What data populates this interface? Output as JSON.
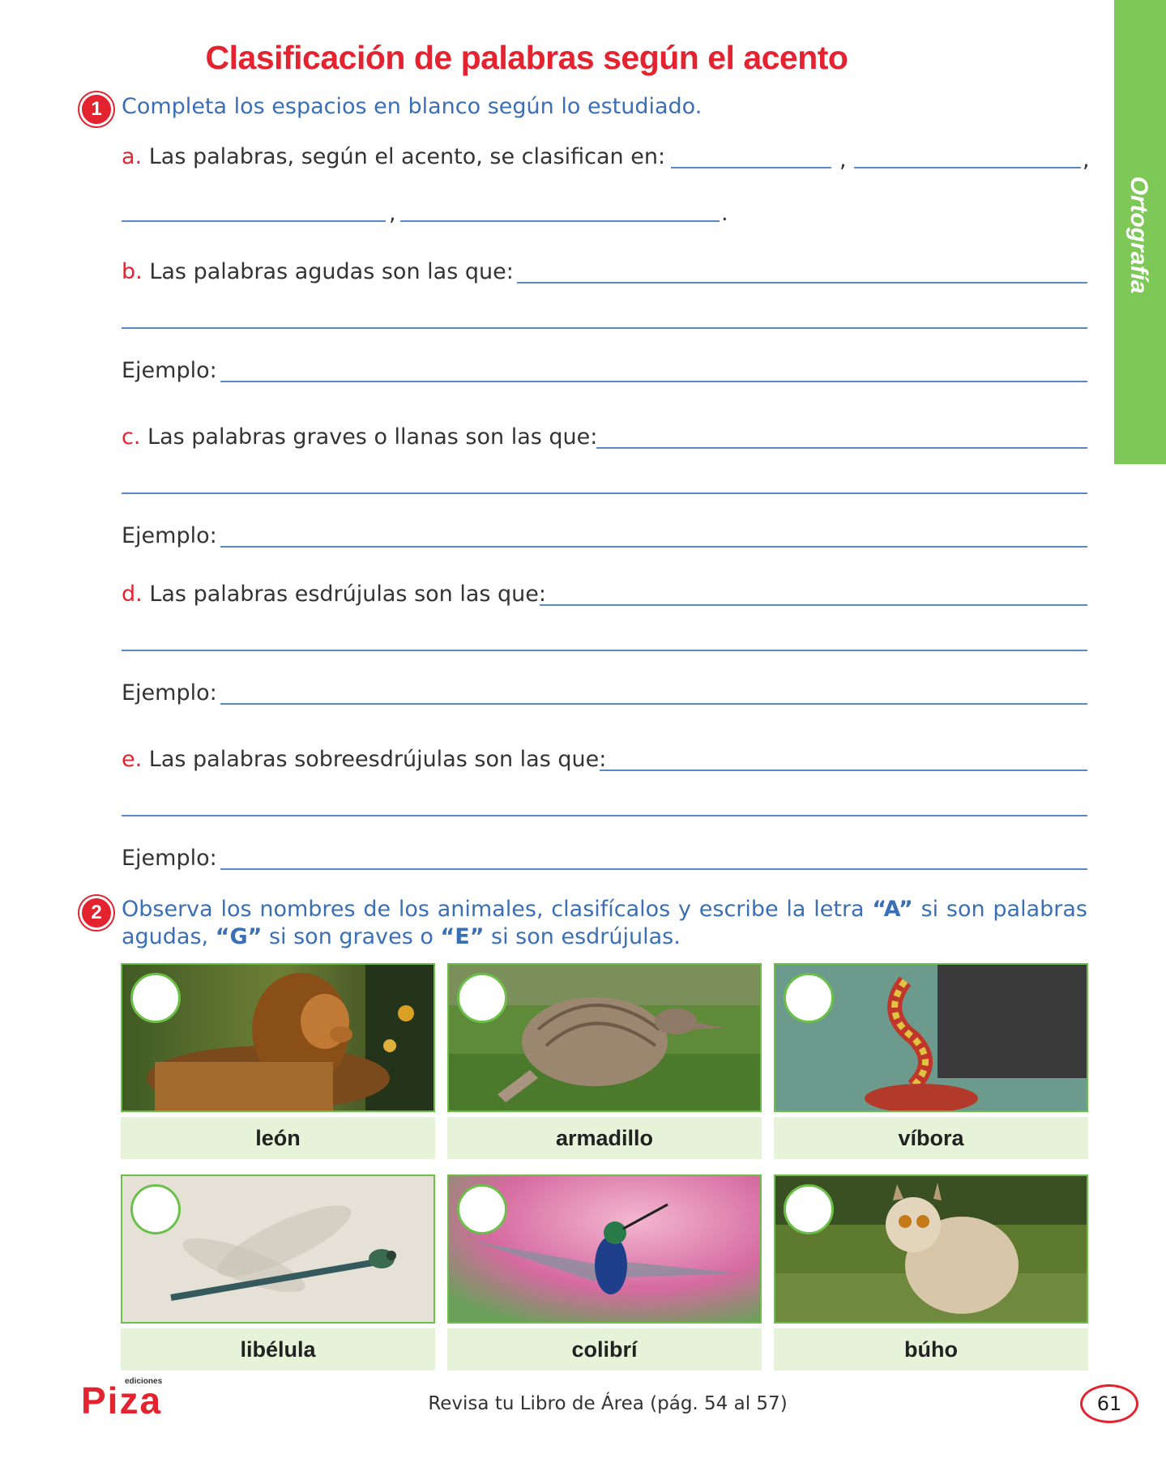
{
  "title": "Clasificación de palabras según el acento",
  "side_tab": "Ortografía",
  "exercise1": {
    "number": "1",
    "instruction": "Completa los espacios en blanco según lo estudiado.",
    "a": {
      "letter": "a.",
      "text": "Las palabras, según el acento, se clasifican en:"
    },
    "b": {
      "letter": "b.",
      "text": "Las palabras agudas son las que:"
    },
    "c": {
      "letter": "c.",
      "text": "Las palabras graves o llanas son las que:"
    },
    "d": {
      "letter": "d.",
      "text": "Las palabras esdrújulas son las que:"
    },
    "e": {
      "letter": "e.",
      "text": "Las palabras sobreesdrújulas son las que:"
    },
    "example_label": "Ejemplo:",
    "comma": ",",
    "period": "."
  },
  "exercise2": {
    "number": "2",
    "instruction_part1": "Observa los nombres de los animales, clasifícalos y escribe la letra ",
    "letter_a": "“A”",
    "instruction_part2": " si son palabras agudas, ",
    "letter_g": "“G”",
    "instruction_part3": " si son graves o ",
    "letter_e": "“E”",
    "instruction_part4": " si son esdrújulas.",
    "animals": [
      "león",
      "armadillo",
      "víbora",
      "libélula",
      "colibrí",
      "búho"
    ]
  },
  "footer": {
    "reference": "Revisa tu Libro de Área (pág. 54 al 57)",
    "page_number": "61",
    "logo": "Piza",
    "logo_small": "ediciones"
  },
  "colors": {
    "title_red": "#e42330",
    "instruction_blue": "#3a6fb6",
    "tab_green": "#7dc856",
    "label_bg": "#e6f3d8"
  }
}
